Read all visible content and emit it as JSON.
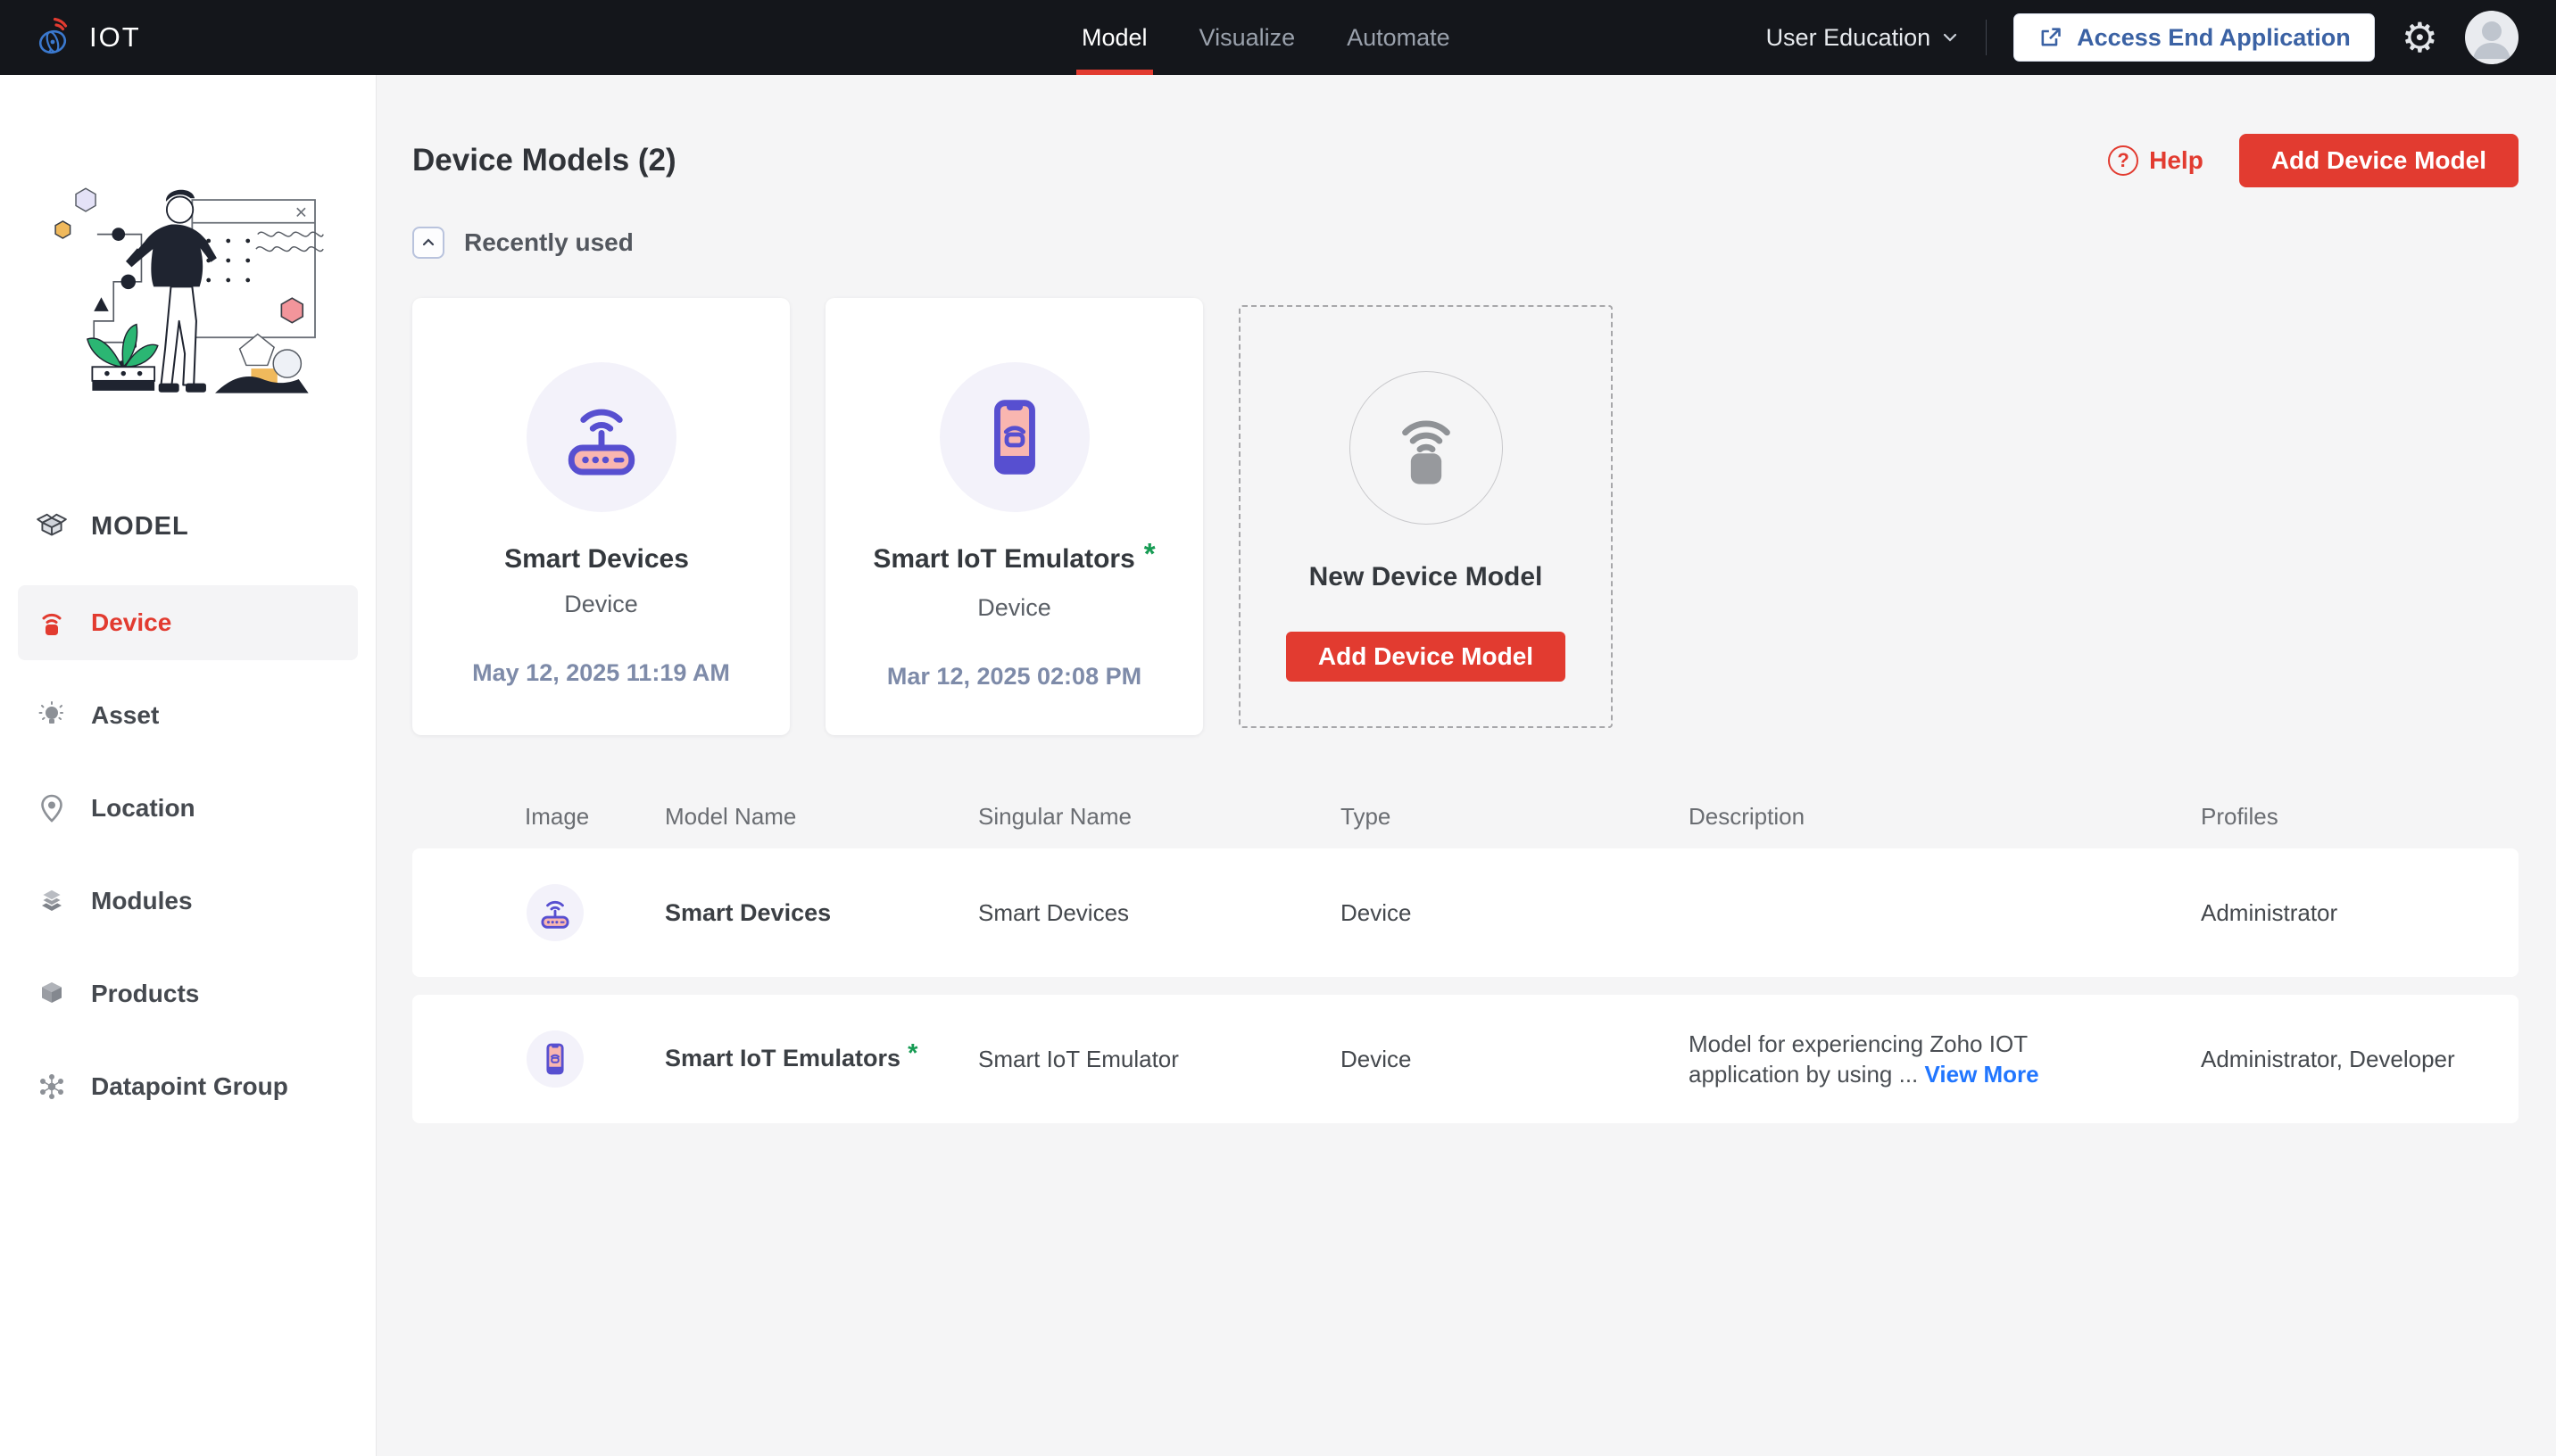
{
  "topbar": {
    "brand": "IOT",
    "tabs": [
      {
        "label": "Model"
      },
      {
        "label": "Visualize"
      },
      {
        "label": "Automate"
      }
    ],
    "org": "User Education",
    "access_button": "Access End Application",
    "gear_glyph": "⚙"
  },
  "page": {
    "title": "Device Models (2)",
    "help": "Help",
    "help_glyph": "?",
    "add_button": "Add Device Model",
    "recently_used": "Recently used"
  },
  "cards": [
    {
      "title": "Smart Devices",
      "type": "Device",
      "date": "May 12, 2025 11:19 AM"
    },
    {
      "title": "Smart IoT Emulators",
      "mark": "*",
      "type": "Device",
      "date": "Mar 12, 2025 02:08 PM"
    }
  ],
  "new_card": {
    "title": "New Device Model",
    "button": "Add Device Model"
  },
  "table": {
    "headers": [
      "Image",
      "Model Name",
      "Singular Name",
      "Type",
      "Description",
      "Profiles"
    ],
    "rows": [
      {
        "model_name": "Smart Devices",
        "singular_name": "Smart Devices",
        "type": "Device",
        "description": "",
        "profiles": "Administrator"
      },
      {
        "model_name": "Smart IoT Emulators",
        "mark": "*",
        "singular_name": "Smart IoT Emulator",
        "type": "Device",
        "description": "Model for experiencing Zoho IOT application by using ...",
        "view_more": "View More",
        "profiles": "Administrator, Developer"
      }
    ]
  },
  "sidebar": {
    "section": "MODEL",
    "items": [
      {
        "label": "Device"
      },
      {
        "label": "Asset"
      },
      {
        "label": "Location"
      },
      {
        "label": "Modules"
      },
      {
        "label": "Products"
      },
      {
        "label": "Datapoint Group"
      }
    ]
  },
  "colors": {
    "accent_red": "#e23b30",
    "indigo": "#574fd0",
    "pink": "#f9b6b0",
    "link_blue": "#2176ff",
    "green_star": "#169b53",
    "topbar_bg": "#14161b"
  }
}
